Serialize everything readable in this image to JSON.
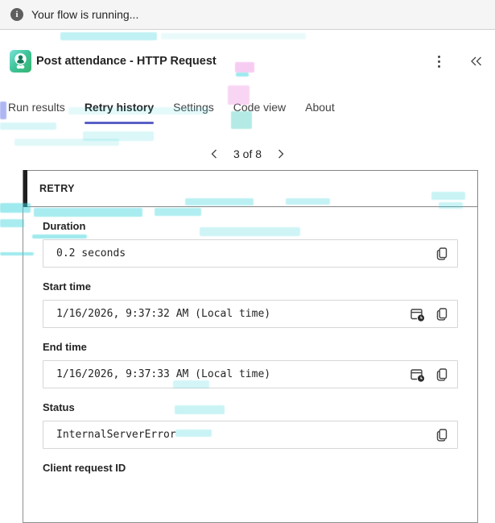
{
  "banner": {
    "message": "Your flow is running..."
  },
  "header": {
    "title": "Post attendance - HTTP Request"
  },
  "tabs": [
    {
      "label": "Run results",
      "active": false
    },
    {
      "label": "Retry history",
      "active": true
    },
    {
      "label": "Settings",
      "active": false
    },
    {
      "label": "Code view",
      "active": false
    },
    {
      "label": "About",
      "active": false
    }
  ],
  "pagination": {
    "current": "3 of 8"
  },
  "retry_card": {
    "header": "RETRY",
    "fields": [
      {
        "label": "Duration",
        "value": "0.2 seconds"
      },
      {
        "label": "Start time",
        "value": "1/16/2026, 9:37:32 AM (Local time)"
      },
      {
        "label": "End time",
        "value": "1/16/2026, 9:37:33 AM (Local time)"
      },
      {
        "label": "Status",
        "value": "InternalServerError"
      },
      {
        "label": "Client request ID"
      }
    ]
  },
  "icons": {
    "banner": "info-circle",
    "app": "person-badge",
    "more": "kebab-vertical",
    "collapse": "double-chevron-left",
    "prev": "chevron-left",
    "next": "chevron-right",
    "copy": "copy-pages",
    "datetime": "calendar-clock"
  },
  "colors": {
    "accent": "#5b5fc7",
    "banner_bg": "#f5f5f5",
    "card_border": "#8a8a8a",
    "card_accent_bar": "#1f1f1f",
    "input_border": "#d6d6d6",
    "text_primary": "#242424",
    "text_secondary": "#424242",
    "app_icon_teal": "#46cdbf",
    "app_icon_green": "#35b673"
  }
}
